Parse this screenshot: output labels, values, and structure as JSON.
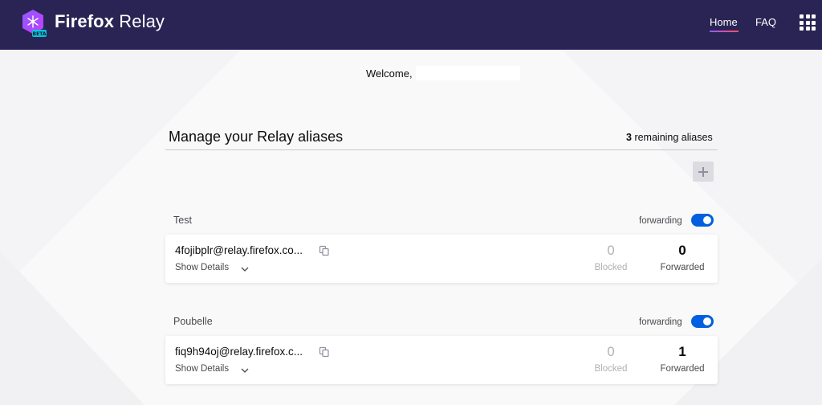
{
  "header": {
    "brand_bold": "Firefox",
    "brand_light": "Relay",
    "logo_badge": "BETA",
    "nav": {
      "home": "Home",
      "faq": "FAQ"
    },
    "apps_icon": "grid-icon"
  },
  "welcome": {
    "text": "Welcome,"
  },
  "manage": {
    "title": "Manage your Relay aliases",
    "remaining_count": "3",
    "remaining_text": "remaining aliases",
    "add_icon": "plus-icon"
  },
  "aliases": [
    {
      "label": "Test",
      "forwarding_text": "forwarding",
      "forwarding_on": true,
      "address": "4fojibplr@relay.firefox.co...",
      "show_details": "Show Details",
      "blocked_count": "0",
      "blocked_label": "Blocked",
      "forwarded_count": "0",
      "forwarded_label": "Forwarded"
    },
    {
      "label": "Poubelle",
      "forwarding_text": "forwarding",
      "forwarding_on": true,
      "address": "fiq9h94oj@relay.firefox.c...",
      "show_details": "Show Details",
      "blocked_count": "0",
      "blocked_label": "Blocked",
      "forwarded_count": "1",
      "forwarded_label": "Forwarded"
    }
  ],
  "colors": {
    "header_bg": "#2a2454",
    "toggle_on": "#0060df",
    "page_bg": "#f9f9fa"
  }
}
